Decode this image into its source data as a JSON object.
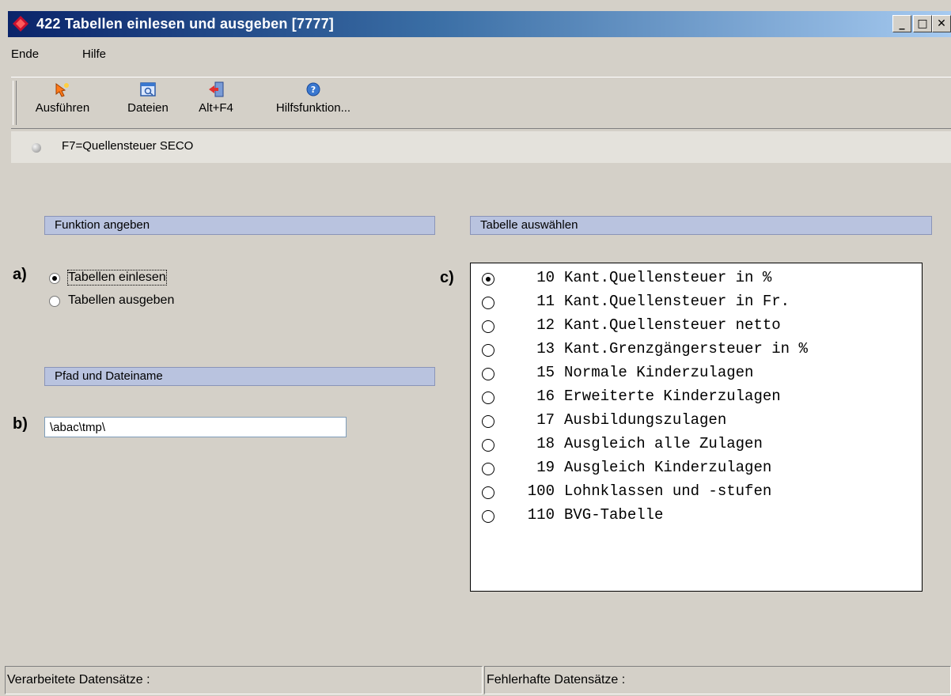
{
  "window": {
    "title": "422 Tabellen einlesen und ausgeben [7777]",
    "minimize_glyph": "_",
    "maximize_glyph": "□",
    "close_glyph": "✕"
  },
  "menu": {
    "end": "Ende",
    "help": "Hilfe"
  },
  "toolbar": {
    "run": "Ausführen",
    "files": "Dateien",
    "altf4": "Alt+F4",
    "help": "Hilfsfunktion..."
  },
  "info": {
    "text": "F7=Quellensteuer SECO"
  },
  "function_section": {
    "header": "Funktion angeben",
    "marker": "a)",
    "options": [
      "Tabellen einlesen",
      "Tabellen ausgeben"
    ],
    "selected": 0
  },
  "path_section": {
    "header": "Pfad und Dateiname",
    "marker": "b)",
    "value": "\\abac\\tmp\\"
  },
  "table_section": {
    "header": "Tabelle auswählen",
    "marker": "c)",
    "items": [
      {
        "num": "10",
        "name": "Kant.Quellensteuer in %"
      },
      {
        "num": "11",
        "name": "Kant.Quellensteuer in Fr."
      },
      {
        "num": "12",
        "name": "Kant.Quellensteuer netto"
      },
      {
        "num": "13",
        "name": "Kant.Grenzgängersteuer in %"
      },
      {
        "num": "15",
        "name": "Normale Kinderzulagen"
      },
      {
        "num": "16",
        "name": "Erweiterte Kinderzulagen"
      },
      {
        "num": "17",
        "name": "Ausbildungszulagen"
      },
      {
        "num": "18",
        "name": "Ausgleich alle Zulagen"
      },
      {
        "num": "19",
        "name": "Ausgleich Kinderzulagen"
      },
      {
        "num": "100",
        "name": "Lohnklassen und -stufen"
      },
      {
        "num": "110",
        "name": "BVG-Tabelle"
      }
    ],
    "selected": 0
  },
  "status": {
    "processed": "Verarbeitete Datensätze :",
    "errors": "Fehlerhafte Datensätze :"
  },
  "colors": {
    "title_start": "#0a246a",
    "title_end": "#a6caf0",
    "section_header": "#b9c3df",
    "window_bg": "#d4d0c8"
  }
}
